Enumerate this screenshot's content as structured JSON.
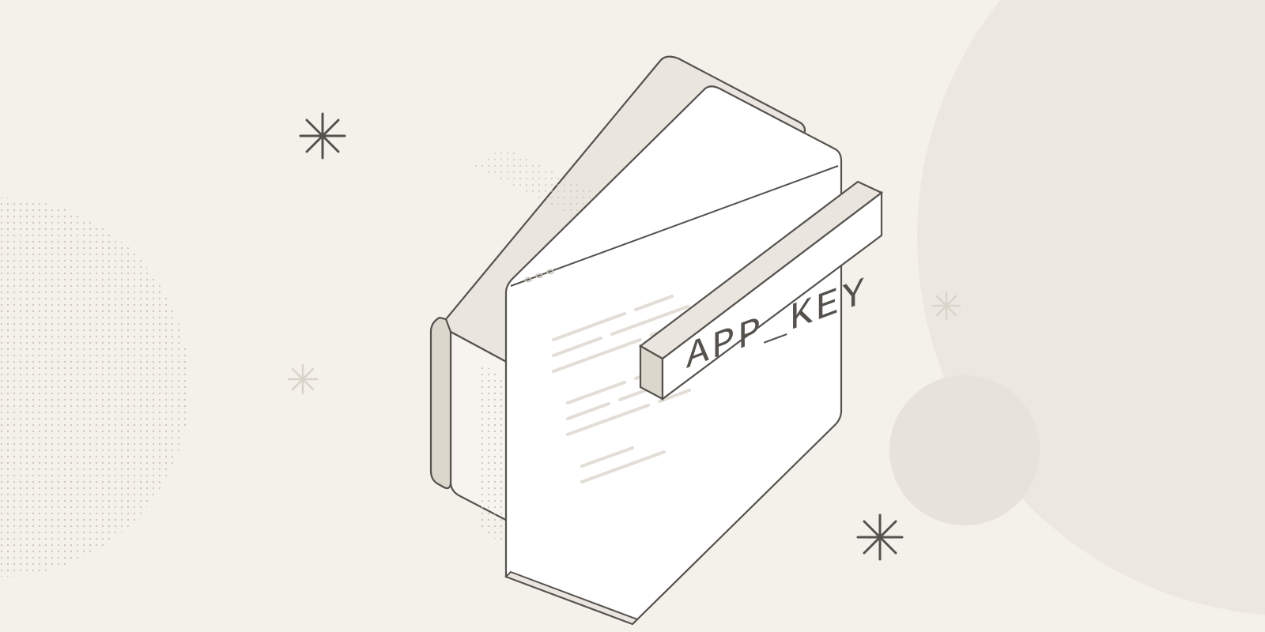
{
  "label": {
    "text": "APP_KEY"
  },
  "colors": {
    "background": "#f4f0ea",
    "stroke_dark": "#55524e",
    "stroke_light": "#e2ddd5",
    "panel_shade": "#eae6df",
    "panel_light": "#fbf9f5",
    "panel_white": "#ffffff",
    "circle_shade": "#ece8e1"
  }
}
